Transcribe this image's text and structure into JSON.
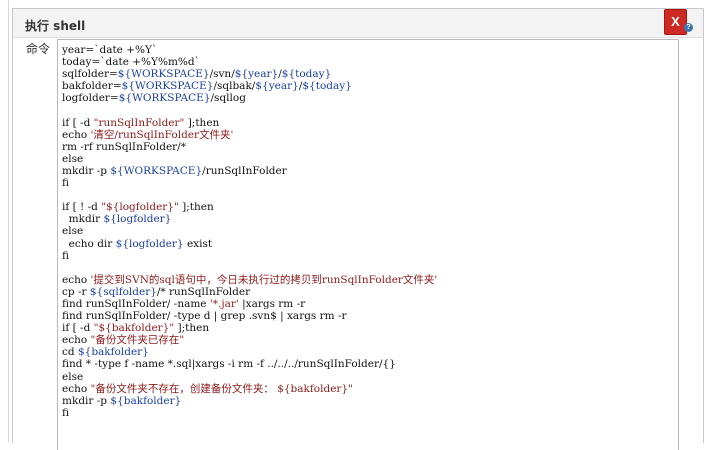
{
  "section": {
    "title": "执行 shell",
    "delete_label": "X",
    "help_label": "?"
  },
  "command": {
    "label": "命令",
    "lines": [
      [
        [
          "year=`date +%Y`",
          "plain"
        ]
      ],
      [
        [
          "today=`date +%Y%m%d`",
          "plain"
        ]
      ],
      [
        [
          "sqlfolder=",
          "plain"
        ],
        [
          "${WORKSPACE}",
          "var"
        ],
        [
          "/svn/",
          "plain"
        ],
        [
          "${year}",
          "var"
        ],
        [
          "/",
          "plain"
        ],
        [
          "${today}",
          "var"
        ]
      ],
      [
        [
          "bakfolder=",
          "plain"
        ],
        [
          "${WORKSPACE}",
          "var"
        ],
        [
          "/sqlbak/",
          "plain"
        ],
        [
          "${year}",
          "var"
        ],
        [
          "/",
          "plain"
        ],
        [
          "${today}",
          "var"
        ]
      ],
      [
        [
          "logfolder=",
          "plain"
        ],
        [
          "${WORKSPACE}",
          "var"
        ],
        [
          "/sqllog",
          "plain"
        ]
      ],
      [
        [
          "",
          "plain"
        ]
      ],
      [
        [
          "if [ -d ",
          "plain"
        ],
        [
          "\"runSqlInFolder\"",
          "str"
        ],
        [
          " ];then",
          "plain"
        ]
      ],
      [
        [
          "echo ",
          "plain"
        ],
        [
          "'清空/runSqlInFolder文件夹'",
          "str"
        ]
      ],
      [
        [
          "rm -rf runSqlInFolder/*",
          "plain"
        ]
      ],
      [
        [
          "else",
          "plain"
        ]
      ],
      [
        [
          "mkdir -p ",
          "plain"
        ],
        [
          "${WORKSPACE}",
          "var"
        ],
        [
          "/runSqlInFolder",
          "plain"
        ]
      ],
      [
        [
          "fi",
          "plain"
        ]
      ],
      [
        [
          "",
          "plain"
        ]
      ],
      [
        [
          "if [ ! -d ",
          "plain"
        ],
        [
          "\"${logfolder}\"",
          "str"
        ],
        [
          " ];then",
          "plain"
        ]
      ],
      [
        [
          "  mkdir ",
          "plain"
        ],
        [
          "${logfolder}",
          "var"
        ]
      ],
      [
        [
          "else",
          "plain"
        ]
      ],
      [
        [
          "  echo dir ",
          "plain"
        ],
        [
          "${logfolder}",
          "var"
        ],
        [
          " exist",
          "plain"
        ]
      ],
      [
        [
          "fi",
          "plain"
        ]
      ],
      [
        [
          "",
          "plain"
        ]
      ],
      [
        [
          "echo ",
          "plain"
        ],
        [
          "'提交到SVN的sql语句中，今日未执行过的拷贝到runSqlInFolder文件夹'",
          "str"
        ]
      ],
      [
        [
          "cp -r ",
          "plain"
        ],
        [
          "${sqlfolder}",
          "var"
        ],
        [
          "/* runSqlInFolder",
          "plain"
        ]
      ],
      [
        [
          "find runSqlInFolder/ -name ",
          "plain"
        ],
        [
          "'*.jar'",
          "str"
        ],
        [
          " |xargs rm -r",
          "plain"
        ]
      ],
      [
        [
          "find runSqlInFolder/ -type d | grep .svn$ | xargs rm -r",
          "plain"
        ]
      ],
      [
        [
          "if [ -d ",
          "plain"
        ],
        [
          "\"${bakfolder}\"",
          "str"
        ],
        [
          " ];then",
          "plain"
        ]
      ],
      [
        [
          "echo ",
          "plain"
        ],
        [
          "\"备份文件夹已存在\"",
          "str"
        ]
      ],
      [
        [
          "cd ",
          "plain"
        ],
        [
          "${bakfolder}",
          "var"
        ]
      ],
      [
        [
          "find * -type f -name *.sql|xargs -i rm -f ../../../runSqlInFolder/{}",
          "plain"
        ]
      ],
      [
        [
          "else",
          "plain"
        ]
      ],
      [
        [
          "echo ",
          "plain"
        ],
        [
          "\"备份文件夹不存在，创建备份文件夹： ${bakfolder}\"",
          "str"
        ]
      ],
      [
        [
          "mkdir -p ",
          "plain"
        ],
        [
          "${bakfolder}",
          "var"
        ]
      ],
      [
        [
          "fi",
          "plain"
        ]
      ]
    ]
  }
}
